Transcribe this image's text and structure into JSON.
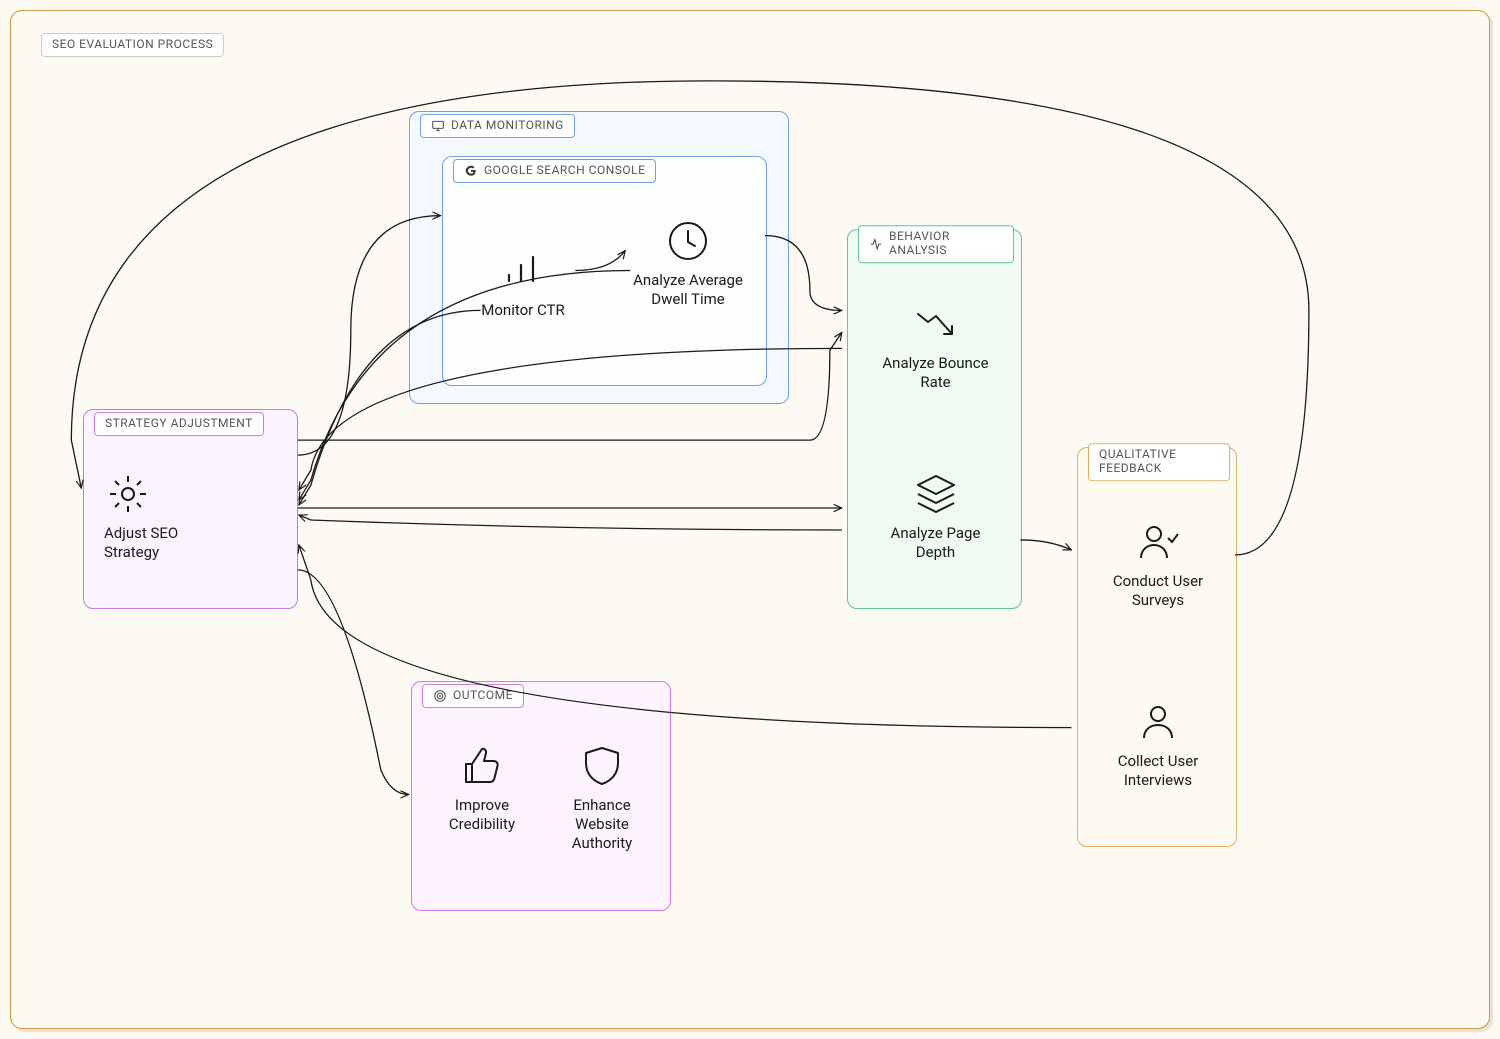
{
  "diagram_title": "SEO EVALUATION PROCESS",
  "groups": {
    "data_monitoring": {
      "label": "DATA MONITORING",
      "color": "#3f7de0"
    },
    "gsc": {
      "label": "GOOGLE SEARCH CONSOLE",
      "color": "#3f7de0"
    },
    "strategy": {
      "label": "STRATEGY ADJUSTMENT",
      "color": "#b84fc7"
    },
    "behavior": {
      "label": "BEHAVIOR ANALYSIS",
      "color": "#2bb673"
    },
    "feedback": {
      "label": "QUALITATIVE FEEDBACK",
      "color": "#d49544"
    },
    "outcome": {
      "label": "OUTCOME",
      "color": "#d04fd6"
    }
  },
  "nodes": {
    "monitor_ctr": {
      "label": "Monitor CTR"
    },
    "dwell_time": {
      "label": "Analyze Average Dwell Time"
    },
    "adjust": {
      "label": "Adjust SEO Strategy"
    },
    "bounce": {
      "label": "Analyze Bounce Rate"
    },
    "page_depth": {
      "label": "Analyze Page Depth"
    },
    "surveys": {
      "label": "Conduct User Surveys"
    },
    "interviews": {
      "label": "Collect User Interviews"
    },
    "credibility": {
      "label": "Improve Credibility"
    },
    "authority": {
      "label": "Enhance Website Authority"
    }
  },
  "edges_description": "Adjust SEO Strategy → Monitor CTR; Monitor CTR → Analyze Average Dwell Time; Analyze Average Dwell Time → Analyze Bounce Rate; Adjust SEO Strategy → Analyze Bounce Rate; Adjust SEO Strategy → Analyze Page Depth; Analyze Page Depth → Conduct User Surveys; Conduct User Surveys → Adjust SEO Strategy (loop back via top); Collect User Interviews → Adjust SEO Strategy; Analyze Bounce Rate → Adjust SEO Strategy; Analyze Page Depth → Adjust SEO Strategy; Analyze Average Dwell Time → Adjust SEO Strategy; Monitor CTR → Adjust SEO Strategy; Adjust SEO Strategy → Outcome (Improve Credibility)"
}
